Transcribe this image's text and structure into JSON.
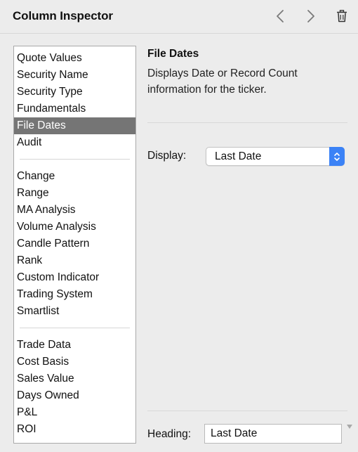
{
  "window": {
    "title": "Column Inspector"
  },
  "toolbar": {
    "prev_icon": "chevron-left-icon",
    "next_icon": "chevron-right-icon",
    "delete_icon": "trash-icon"
  },
  "list": {
    "groups": [
      [
        "Quote Values",
        "Security Name",
        "Security Type",
        "Fundamentals",
        "File Dates",
        "Audit"
      ],
      [
        "Change",
        "Range",
        "MA Analysis",
        "Volume Analysis",
        "Candle Pattern",
        "Rank",
        "Custom Indicator",
        "Trading System",
        "Smartlist"
      ],
      [
        "Trade Data",
        "Cost Basis",
        "Sales Value",
        "Days Owned",
        "P&L",
        "ROI"
      ]
    ],
    "selected": "File Dates"
  },
  "panel": {
    "title": "File Dates",
    "description": "Displays Date or Record Count information for the ticker.",
    "display_label": "Display:",
    "display_value": "Last Date",
    "heading_label": "Heading:",
    "heading_value": "Last Date"
  },
  "colors": {
    "selection": "#757575",
    "accent": "#3b82f6",
    "window_bg": "#ececec"
  }
}
